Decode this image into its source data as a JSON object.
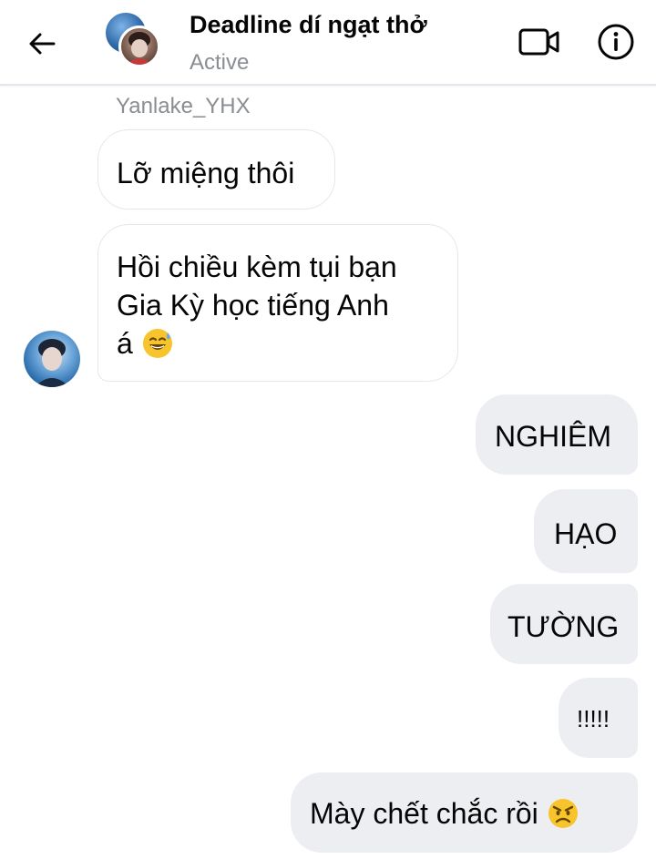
{
  "header": {
    "back_icon": "arrow-left-icon",
    "title": "Deadline dí ngạt thở",
    "status": "Active",
    "video_icon": "video-camera-icon",
    "info_icon": "info-circle-icon"
  },
  "thread": {
    "incoming_sender_name": "Yanlake_YHX",
    "incoming": [
      {
        "text": "Lỡ miệng thôi"
      },
      {
        "lines": [
          "Hồi chiều kèm tụi bạn",
          "Gia Kỳ học tiếng Anh",
          "á"
        ],
        "emoji": "grinning-sweat-emoji"
      }
    ],
    "outgoing": [
      {
        "text": "NGHIÊM"
      },
      {
        "text": "HẠO"
      },
      {
        "text": "TƯỜNG"
      },
      {
        "text": "!!!!!"
      },
      {
        "text": "Mày chết chắc rồi",
        "emoji": "angry-face-emoji"
      }
    ]
  },
  "colors": {
    "outgoing_bubble": "#eceef1",
    "incoming_border": "#e6e7eb",
    "muted_text": "#8a8d91",
    "emoji_yellow": "#f7c52b"
  }
}
